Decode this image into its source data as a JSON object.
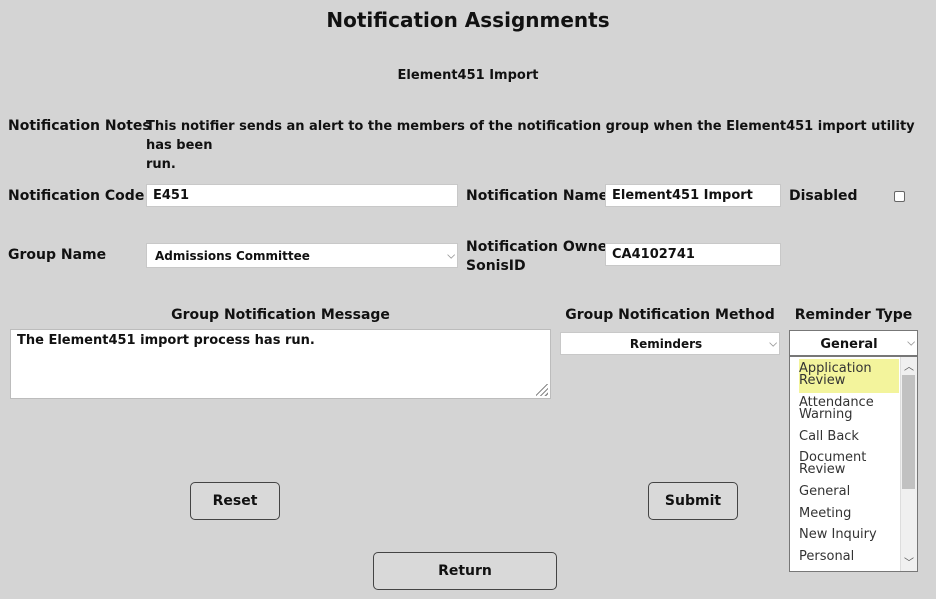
{
  "page_title": "Notification Assignments",
  "subtitle": "Element451 Import",
  "notes": {
    "label": "Notification Notes",
    "text_line1": "This notifier sends an alert to the members of the notification group when the Element451 import utility has been",
    "text_line2": "run."
  },
  "notification_code": {
    "label": "Notification Code",
    "value": "E451"
  },
  "notification_name": {
    "label": "Notification Name",
    "value": "Element451 Import"
  },
  "disabled": {
    "label": "Disabled",
    "checked": false
  },
  "group_name": {
    "label": "Group Name",
    "value": "Admissions Committee"
  },
  "owner": {
    "label_line1": "Notification Owner",
    "label_line2": "SonisID",
    "value": "CA4102741"
  },
  "group_message": {
    "label": "Group Notification Message",
    "value": "The Element451 import process has run."
  },
  "group_method": {
    "label": "Group Notification Method",
    "value": "Reminders"
  },
  "reminder_type": {
    "label": "Reminder Type",
    "value": "General",
    "options": [
      {
        "line1": "Application",
        "line2": "Review"
      },
      {
        "line1": "Attendance",
        "line2": "Warning"
      },
      {
        "line1": "Call Back",
        "line2": ""
      },
      {
        "line1": "Document",
        "line2": "Review"
      },
      {
        "line1": "General",
        "line2": ""
      },
      {
        "line1": "Meeting",
        "line2": ""
      },
      {
        "line1": "New Inquiry",
        "line2": ""
      },
      {
        "line1": "Personal",
        "line2": ""
      }
    ],
    "highlight_color": "#f3f49c"
  },
  "buttons": {
    "reset": "Reset",
    "submit": "Submit",
    "return": "Return"
  },
  "icons": {
    "select_arrow": "chevron-down-icon",
    "scroll_up": "chevron-up-icon",
    "scroll_down": "chevron-down-icon"
  }
}
